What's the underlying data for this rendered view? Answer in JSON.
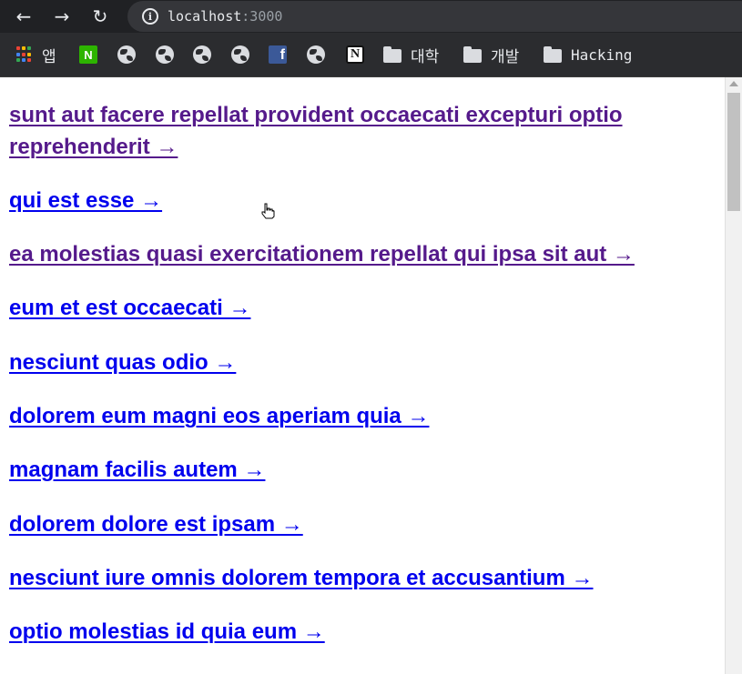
{
  "browser": {
    "url_host": "localhost",
    "url_port": ":3000",
    "back_glyph": "←",
    "forward_glyph": "→",
    "reload_glyph": "↻",
    "info_glyph": "i"
  },
  "bookmarks": [
    {
      "icon": "apps-grid-icon",
      "label": "앱"
    },
    {
      "icon": "naver-icon",
      "glyph": "N",
      "label": ""
    },
    {
      "icon": "globe-icon",
      "label": ""
    },
    {
      "icon": "globe-icon",
      "label": ""
    },
    {
      "icon": "globe-icon",
      "label": ""
    },
    {
      "icon": "globe-icon",
      "label": ""
    },
    {
      "icon": "facebook-icon",
      "glyph": "f",
      "label": ""
    },
    {
      "icon": "globe-icon",
      "label": ""
    },
    {
      "icon": "notion-icon",
      "glyph": "N",
      "label": ""
    },
    {
      "icon": "folder-icon",
      "label": "대학"
    },
    {
      "icon": "folder-icon",
      "label": "개발"
    },
    {
      "icon": "folder-icon",
      "label": "Hacking"
    }
  ],
  "posts": [
    {
      "title": "sunt aut facere repellat provident occaecati excepturi optio reprehenderit →",
      "visited": true
    },
    {
      "title": "qui est esse →",
      "visited": false
    },
    {
      "title": "ea molestias quasi exercitationem repellat qui ipsa sit aut →",
      "visited": true
    },
    {
      "title": "eum et est occaecati →",
      "visited": false
    },
    {
      "title": "nesciunt quas odio →",
      "visited": false
    },
    {
      "title": "dolorem eum magni eos aperiam quia →",
      "visited": false
    },
    {
      "title": "magnam facilis autem →",
      "visited": false
    },
    {
      "title": "dolorem dolore est ipsam →",
      "visited": false
    },
    {
      "title": "nesciunt iure omnis dolorem tempora et accusantium →",
      "visited": false
    },
    {
      "title": "optio molestias id quia eum →",
      "visited": false
    }
  ],
  "colors": {
    "link_visited": "#551a8b",
    "link_unvisited": "#0000ee",
    "toolbar_bg": "#202124",
    "bookmarks_bg": "#2b2c2f"
  }
}
